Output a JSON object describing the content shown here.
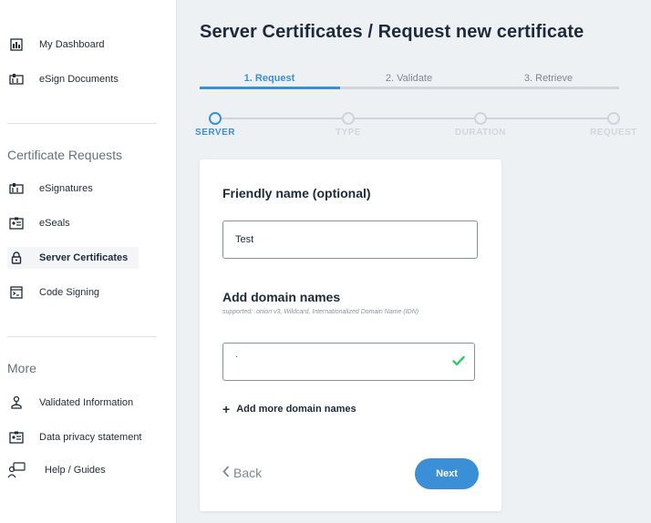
{
  "sidebar": {
    "items_top": [
      {
        "label": "My Dashboard",
        "icon": "dashboard-icon"
      },
      {
        "label": "eSign Documents",
        "icon": "esign-documents-icon"
      }
    ],
    "section1_title": "Certificate Requests",
    "items_requests": [
      {
        "label": "eSignatures",
        "icon": "esignatures-icon"
      },
      {
        "label": "eSeals",
        "icon": "eseals-icon"
      },
      {
        "label": "Server Certificates",
        "icon": "lock-icon"
      },
      {
        "label": "Code Signing",
        "icon": "code-signing-icon"
      }
    ],
    "section2_title": "More",
    "items_more": [
      {
        "label": "Validated Information",
        "icon": "validated-info-icon"
      },
      {
        "label": "Data privacy statement",
        "icon": "privacy-icon"
      },
      {
        "label": "Help / Guides",
        "icon": "help-icon"
      }
    ]
  },
  "header": {
    "title": "Server Certificates / Request new certificate"
  },
  "tabs": [
    {
      "label": "1. Request"
    },
    {
      "label": "2. Validate"
    },
    {
      "label": "3. Retrieve"
    }
  ],
  "stepper": [
    {
      "label": "SERVER"
    },
    {
      "label": "TYPE"
    },
    {
      "label": "DURATION"
    },
    {
      "label": "REQUEST"
    }
  ],
  "form": {
    "friendly_name_heading": "Friendly name (optional)",
    "friendly_name_value": "Test",
    "domain_heading": "Add domain names",
    "domain_hint": "supported: .onion v3, Wildcard, Internationalized Domain Name (IDN)",
    "domain_value": "·",
    "add_more_label": "Add more domain names",
    "back_label": "Back",
    "next_label": "Next"
  },
  "colors": {
    "accent": "#3a8fd6",
    "check": "#2ecc71",
    "text": "#1d2a3a"
  }
}
